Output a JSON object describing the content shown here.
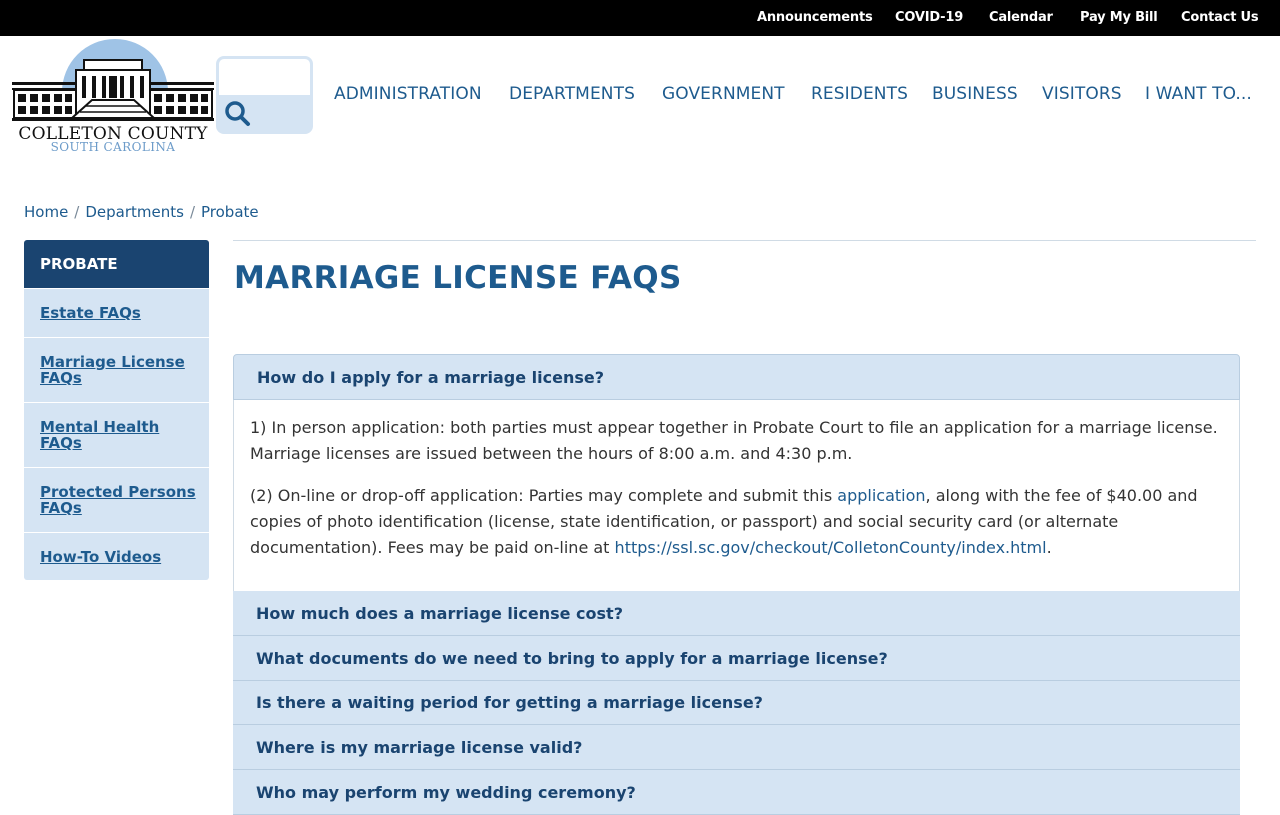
{
  "topbar": {
    "links": [
      "Announcements",
      "COVID-19",
      "Calendar",
      "Pay My Bill",
      "Contact Us"
    ]
  },
  "logo": {
    "line1": "COLLETON COUNTY",
    "line2": "SOUTH CAROLINA"
  },
  "search": {
    "placeholder": "",
    "icon": "search-icon"
  },
  "mainnav": {
    "items": [
      "ADMINISTRATION",
      "DEPARTMENTS",
      "GOVERNMENT",
      "RESIDENTS",
      "BUSINESS",
      "VISITORS",
      "I WANT TO..."
    ]
  },
  "breadcrumb": {
    "items": [
      "Home",
      "Departments",
      "Probate"
    ],
    "separator": "/"
  },
  "sidebar": {
    "heading": "PROBATE",
    "items": [
      "Estate FAQs",
      "Marriage License FAQs",
      "Mental Health FAQs",
      "Protected Persons FAQs",
      "How-To Videos"
    ]
  },
  "page": {
    "title": "MARRIAGE LICENSE FAQS"
  },
  "faq": {
    "open": {
      "question": "How do I apply for a marriage license?",
      "p1": "1) In person application:  both parties must appear together in Probate Court to file an application for a marriage license. Marriage licenses are issued between the hours of 8:00 a.m. and 4:30 p.m.",
      "p2_before": "(2) On-line or drop-off application:  Parties may complete and submit this ",
      "p2_link": "application",
      "p2_middle": ", along with the fee of $40.00 and copies of photo identification (license, state identification, or passport) and social security card (or alternate documentation).  Fees may be paid on-line at ",
      "p2_url": "https://ssl.sc.gov/checkout/ColletonCounty/index.html",
      "p2_after": "."
    },
    "collapsed": [
      "How much does a marriage license cost?",
      "What documents do we need to bring to apply for a marriage license?",
      "Is there a waiting period for getting a marriage license?",
      "Where is my marriage license valid?",
      "Who may perform my wedding ceremony?"
    ]
  },
  "colors": {
    "topbar": "#000000",
    "brand": "#1e5b8e",
    "sidebar_head": "#1a4470",
    "light_panel": "#d5e4f3"
  }
}
